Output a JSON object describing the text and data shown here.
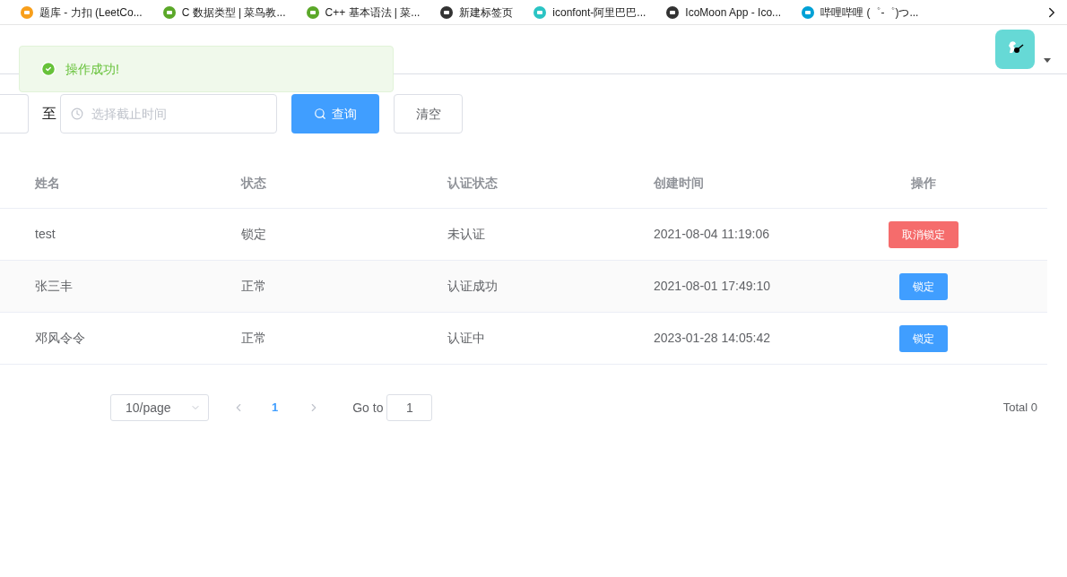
{
  "bookmarks": [
    {
      "label": "题库 - 力扣 (LeetCo..."
    },
    {
      "label": "C 数据类型 | 菜鸟教..."
    },
    {
      "label": "C++ 基本语法 | 菜..."
    },
    {
      "label": "新建标签页"
    },
    {
      "label": "iconfont-阿里巴巴..."
    },
    {
      "label": "IcoMoon App - Ico..."
    },
    {
      "label": "哔哩哔哩 (゜-゜)つ..."
    }
  ],
  "toast": {
    "kind": "success",
    "message": "操作成功!"
  },
  "filter": {
    "separator": "至",
    "end_date": {
      "placeholder": "选择截止时间"
    },
    "search_button": "查询",
    "clear_button": "清空"
  },
  "table": {
    "columns": [
      "姓名",
      "状态",
      "认证状态",
      "创建时间",
      "操作"
    ],
    "rows": [
      {
        "name": "test",
        "status": "锁定",
        "auth": "未认证",
        "created": "2021-08-04 11:19:06",
        "action": {
          "kind": "danger",
          "label": "取消锁定"
        }
      },
      {
        "name": "张三丰",
        "status": "正常",
        "auth": "认证成功",
        "created": "2021-08-01 17:49:10",
        "action": {
          "kind": "primary",
          "label": "锁定"
        }
      },
      {
        "name": "邓风令令",
        "status": "正常",
        "auth": "认证中",
        "created": "2023-01-28 14:05:42",
        "action": {
          "kind": "primary",
          "label": "锁定"
        }
      }
    ]
  },
  "pagination": {
    "page_size": "10/page",
    "pages": [
      {
        "label": "1",
        "selected": true
      }
    ],
    "goto_label": "Go to",
    "goto_value": "1",
    "total": "Total 0"
  }
}
